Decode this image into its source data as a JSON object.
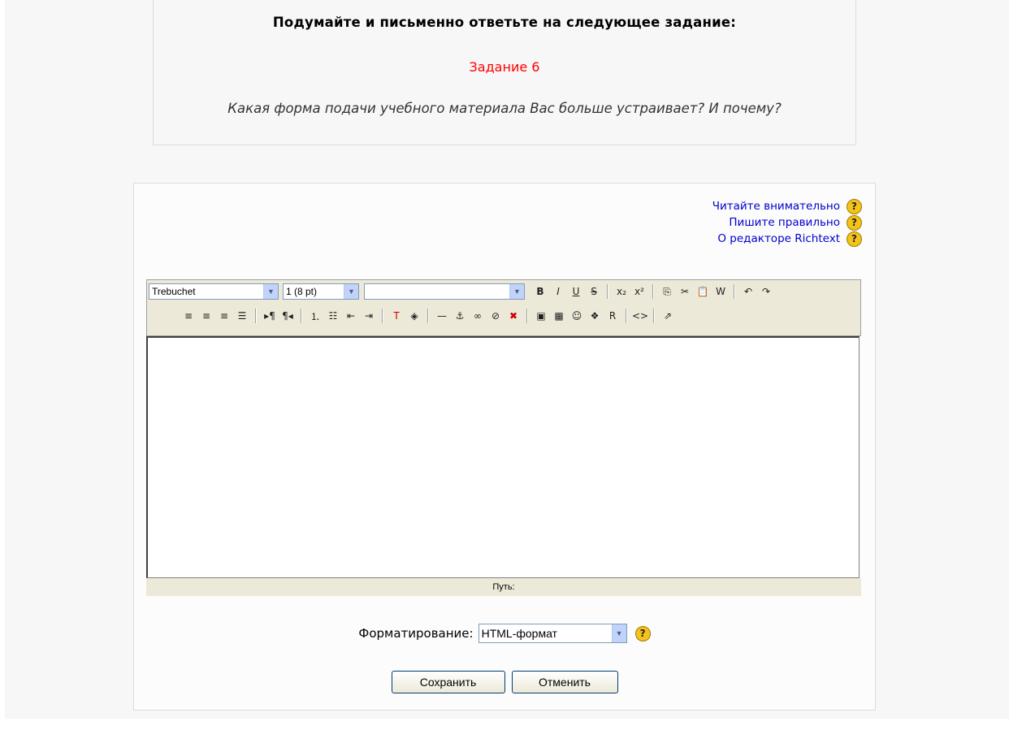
{
  "task": {
    "title": "Подумайте и письменно ответьте на следующее задание:",
    "number": "Задание 6",
    "question": "Какая форма подачи учебного материала Вас больше устраивает? И почему?"
  },
  "help_links": [
    {
      "label": "Читайте внимательно"
    },
    {
      "label": "Пишите правильно"
    },
    {
      "label": "О редакторе Richtext"
    }
  ],
  "help_icon": "?",
  "toolbar": {
    "font_family": "Trebuchet",
    "font_size": "1 (8 pt)",
    "heading": "",
    "row1_buttons": [
      {
        "name": "bold-button",
        "glyph": "B"
      },
      {
        "name": "italic-button",
        "glyph": "I"
      },
      {
        "name": "underline-button",
        "glyph": "U"
      },
      {
        "name": "strikethrough-button",
        "glyph": "S"
      },
      {
        "sep": true
      },
      {
        "name": "subscript-button",
        "glyph": "x₂"
      },
      {
        "name": "superscript-button",
        "glyph": "x²"
      },
      {
        "sep": true
      },
      {
        "name": "copy-button",
        "glyph": "⎘"
      },
      {
        "name": "cut-button",
        "glyph": "✂"
      },
      {
        "name": "paste-button",
        "glyph": "📋"
      },
      {
        "name": "paste-word-button",
        "glyph": "W"
      },
      {
        "sep": true
      },
      {
        "name": "undo-button",
        "glyph": "↶"
      },
      {
        "name": "redo-button",
        "glyph": "↷"
      }
    ],
    "row2_buttons": [
      {
        "name": "align-left-button",
        "glyph": "≡"
      },
      {
        "name": "align-center-button",
        "glyph": "≡"
      },
      {
        "name": "align-right-button",
        "glyph": "≡"
      },
      {
        "name": "justify-button",
        "glyph": "☰"
      },
      {
        "sep": true
      },
      {
        "name": "ltr-button",
        "glyph": "▸¶"
      },
      {
        "name": "rtl-button",
        "glyph": "¶◂"
      },
      {
        "sep": true
      },
      {
        "name": "ordered-list-button",
        "glyph": "⒈"
      },
      {
        "name": "unordered-list-button",
        "glyph": "☷"
      },
      {
        "name": "outdent-button",
        "glyph": "⇤"
      },
      {
        "name": "indent-button",
        "glyph": "⇥"
      },
      {
        "sep": true
      },
      {
        "name": "text-color-button",
        "glyph": "T"
      },
      {
        "name": "bg-color-button",
        "glyph": "◈"
      },
      {
        "sep": true
      },
      {
        "name": "horizontal-rule-button",
        "glyph": "—"
      },
      {
        "name": "anchor-button",
        "glyph": "⚓"
      },
      {
        "name": "link-button",
        "glyph": "∞"
      },
      {
        "name": "unlink-button",
        "glyph": "⊘"
      },
      {
        "name": "nolink-button",
        "glyph": "✖"
      },
      {
        "sep": true
      },
      {
        "name": "insert-image-button",
        "glyph": "▣"
      },
      {
        "name": "insert-table-button",
        "glyph": "▦"
      },
      {
        "name": "smiley-button",
        "glyph": "☺"
      },
      {
        "name": "special-char-button",
        "glyph": "❖"
      },
      {
        "name": "search-replace-button",
        "glyph": "R"
      },
      {
        "sep": true
      },
      {
        "name": "html-source-button",
        "glyph": "<>"
      },
      {
        "sep": true
      },
      {
        "name": "fullscreen-button",
        "glyph": "⇗"
      }
    ]
  },
  "statusbar": "Путь:",
  "format": {
    "label": "Форматирование:",
    "value": "HTML-формат"
  },
  "buttons": {
    "save": "Сохранить",
    "cancel": "Отменить"
  },
  "colors": {
    "task_number": "#ff0000",
    "link": "#0000cc",
    "toolbar_bg": "#ece9d8"
  }
}
